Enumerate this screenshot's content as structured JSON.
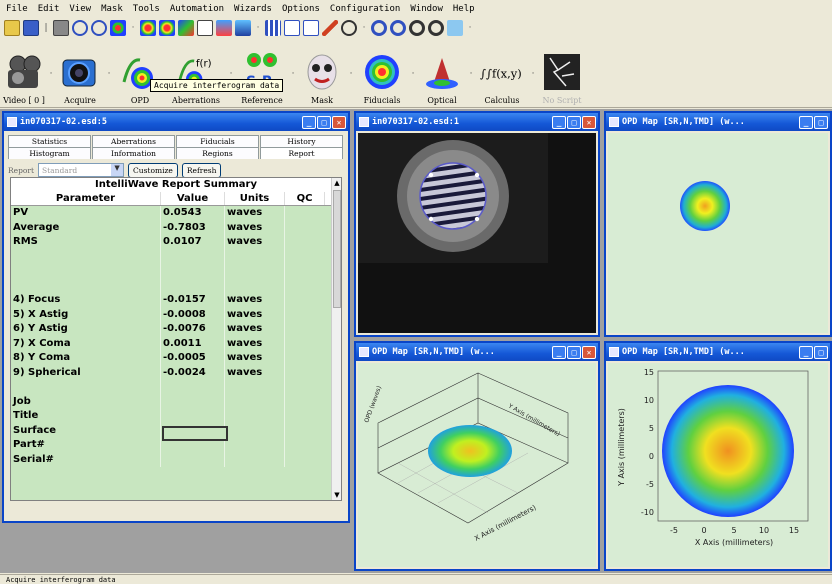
{
  "menu": [
    "File",
    "Edit",
    "View",
    "Mask",
    "Tools",
    "Automation",
    "Wizards",
    "Options",
    "Configuration",
    "Window",
    "Help"
  ],
  "toolbar_big": {
    "video_label": "Video [ 0 ]",
    "acquire_label": "Acquire",
    "opd_label": "OPD",
    "aberrations_label": "Aberrations",
    "opd_icon_text": "f(r)",
    "reference_label": "Reference",
    "reference_icon_text": "S-R",
    "mask_label": "Mask",
    "fiducials_label": "Fiducials",
    "optical_label": "Optical",
    "calculus_label": "Calculus",
    "calculus_icon_text": "∫∫f(x,y) dx dy",
    "noscript_label": "No Script",
    "tooltip": "Acquire interferogram data"
  },
  "windows": {
    "report": {
      "title": "in070317-02.esd:5",
      "tabs_row1": [
        "Statistics",
        "Aberrations",
        "Fiducials",
        "History"
      ],
      "tabs_row2": [
        "Histogram",
        "Information",
        "Regions",
        "Report"
      ],
      "report_label": "Report",
      "report_value": "Standard",
      "customize_label": "Customize",
      "refresh_label": "Refresh",
      "grid_title": "IntelliWave Report Summary",
      "columns": [
        "Parameter",
        "Value",
        "Units",
        "QC"
      ],
      "rows": [
        [
          "PV",
          "0.0543",
          "waves",
          ""
        ],
        [
          "Average",
          "-0.7803",
          "waves",
          ""
        ],
        [
          "RMS",
          "0.0107",
          "waves",
          ""
        ],
        [
          "",
          "",
          "",
          ""
        ],
        [
          "",
          "",
          "",
          ""
        ],
        [
          "",
          "",
          "",
          ""
        ],
        [
          "4) Focus",
          "-0.0157",
          "waves",
          ""
        ],
        [
          "5) X Astig",
          "-0.0008",
          "waves",
          ""
        ],
        [
          "6) Y Astig",
          "-0.0076",
          "waves",
          ""
        ],
        [
          "7) X Coma",
          "0.0011",
          "waves",
          ""
        ],
        [
          "8) Y Coma",
          "-0.0005",
          "waves",
          ""
        ],
        [
          "9) Spherical",
          "-0.0024",
          "waves",
          ""
        ],
        [
          "",
          "",
          "",
          ""
        ],
        [
          "Job",
          "",
          "",
          ""
        ],
        [
          "Title",
          "",
          "",
          ""
        ],
        [
          "Surface",
          "",
          "",
          ""
        ],
        [
          "Part#",
          "",
          "",
          ""
        ],
        [
          "Serial#",
          "",
          "",
          ""
        ]
      ]
    },
    "interferogram": {
      "title": "in070317-02.esd:1"
    },
    "opd_top": {
      "title": "OPD Map [SR,N,TMD] (w..."
    },
    "opd_3d": {
      "title": "OPD Map [SR,N,TMD] (w...",
      "x_axis_label": "X Axis (millimeters)",
      "y_axis_label": "Y Axis (millimeters)",
      "z_axis_label": "OPD (waves)"
    },
    "opd_2d": {
      "title": "OPD Map [SR,N,TMD] (w...",
      "x_axis_label": "X Axis (millimeters)",
      "y_axis_label": "Y Axis (millimeters)",
      "x_ticks": [
        "-5",
        "0",
        "5",
        "10",
        "15"
      ],
      "y_ticks": [
        "15",
        "10",
        "5",
        "0",
        "-5",
        "-10"
      ]
    }
  },
  "status": "Acquire interferogram data",
  "colors": {
    "titlebar": "#1457d6",
    "grid_bg": "#c8e6c0",
    "plot_bg": "#d8ecd4"
  }
}
